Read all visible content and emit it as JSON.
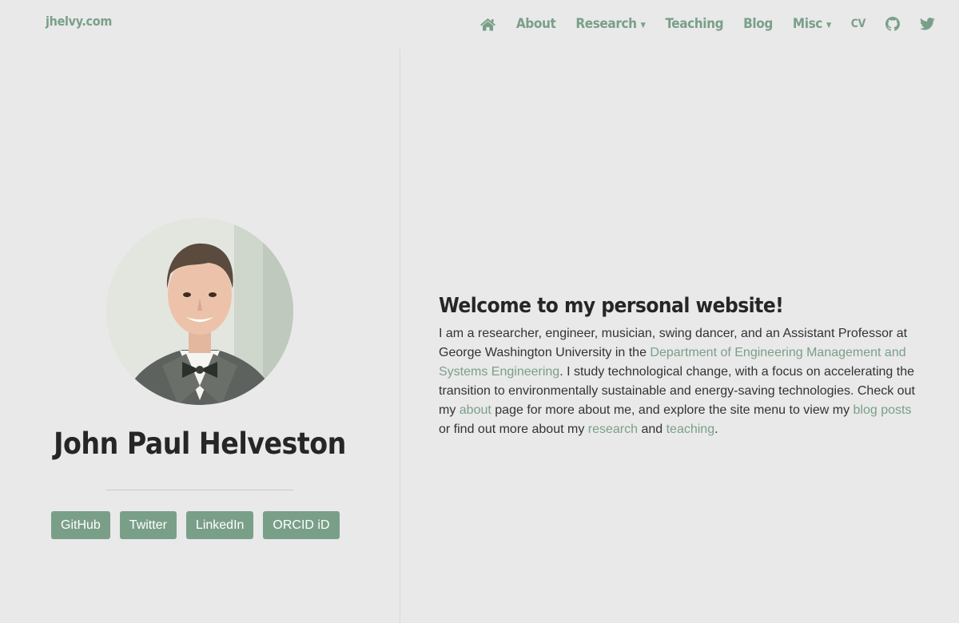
{
  "brand": "jhelvy.com",
  "nav": {
    "home_icon": "home-icon",
    "about": "About",
    "research": "Research",
    "teaching": "Teaching",
    "blog": "Blog",
    "misc": "Misc",
    "cv": "CV",
    "github_icon": "github-icon",
    "twitter_icon": "twitter-icon"
  },
  "profile": {
    "name": "John Paul Helveston",
    "buttons": [
      "GitHub",
      "Twitter",
      "LinkedIn",
      "ORCID iD"
    ]
  },
  "welcome": {
    "title": "Welcome to my personal website!",
    "text1": "I am a researcher, engineer, musician, swing dancer, and an Assistant Professor at George Washington University in the ",
    "link_dept": "Department of Engineering Management and Systems Engineering",
    "text2": ". I study technological change, with a focus on accelerating the transition to environmentally sustainable and energy-saving technologies. Check out my ",
    "link_about": "about",
    "text3": " page for more about me, and explore the site menu to view my ",
    "link_blog": "blog posts",
    "text4": " or find out more about my ",
    "link_research": "research",
    "text5": " and ",
    "link_teaching": "teaching",
    "text6": "."
  },
  "colors": {
    "accent": "#7a9f89",
    "background": "#e9e9e9",
    "text": "#262626"
  }
}
